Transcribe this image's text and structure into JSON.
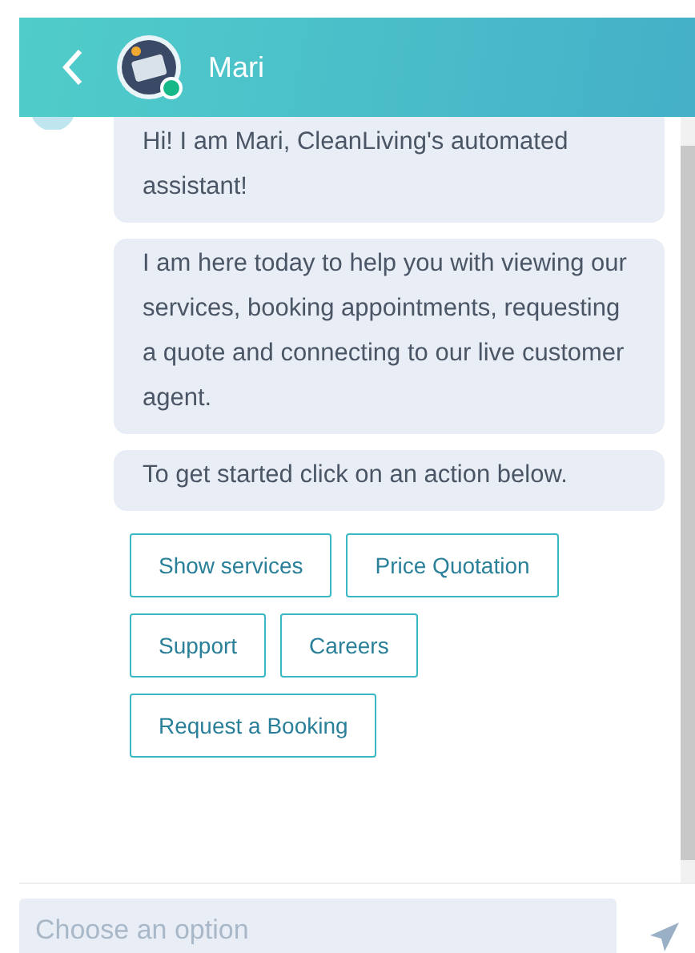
{
  "header": {
    "title": "Mari",
    "online": true
  },
  "messages": [
    {
      "text": "Hi! I am Mari, CleanLiving's automated assistant!"
    },
    {
      "text": "I am here today to help you with viewing our services, booking appointments, requesting a quote and connecting to our live customer agent."
    },
    {
      "text": "To get started click on an action below."
    }
  ],
  "actions": [
    [
      "Show services",
      "Price Quotation"
    ],
    [
      "Support",
      "Careers"
    ],
    [
      "Request a Booking"
    ]
  ],
  "input": {
    "placeholder": "Choose an option"
  }
}
